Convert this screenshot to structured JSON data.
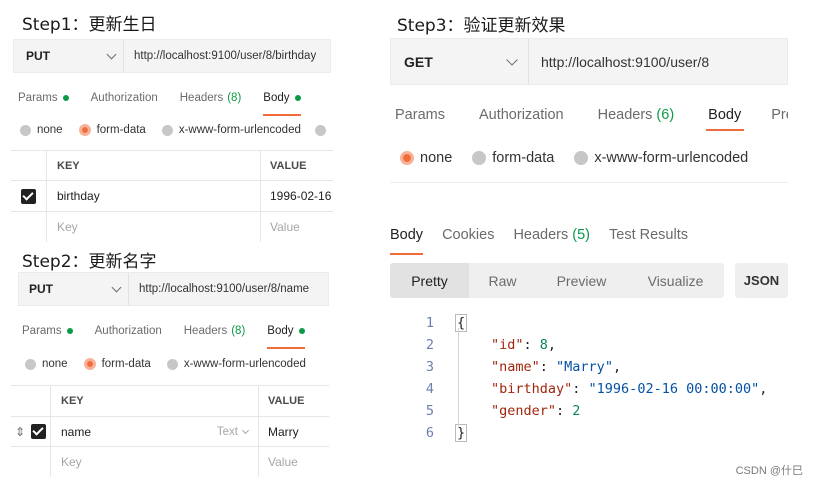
{
  "panel1": {
    "step_title": "Step1：更新生日",
    "method": "PUT",
    "url": "http://localhost:9100/user/8/birthday",
    "tabs": {
      "params": "Params",
      "authorization": "Authorization",
      "headers": "Headers",
      "headers_count": "(8)",
      "body": "Body"
    },
    "body_types": [
      "none",
      "form-data",
      "x-www-form-urlencoded"
    ],
    "table": {
      "col_key": "KEY",
      "col_value": "VALUE",
      "rows": [
        {
          "key": "birthday",
          "value": "1996-02-16",
          "checked": true
        }
      ],
      "key_placeholder": "Key",
      "value_placeholder": "Value"
    }
  },
  "panel2": {
    "step_title": "Step2：更新名字",
    "method": "PUT",
    "url": "http://localhost:9100/user/8/name",
    "tabs": {
      "params": "Params",
      "authorization": "Authorization",
      "headers": "Headers",
      "headers_count": "(8)",
      "body": "Body"
    },
    "body_types": [
      "none",
      "form-data",
      "x-www-form-urlencoded"
    ],
    "table": {
      "col_key": "KEY",
      "col_value": "VALUE",
      "rows": [
        {
          "key": "name",
          "type": "Text",
          "value": "Marry",
          "checked": true
        }
      ],
      "key_placeholder": "Key",
      "value_placeholder": "Value"
    }
  },
  "panel3": {
    "step_title": "Step3：验证更新效果",
    "method": "GET",
    "url": "http://localhost:9100/user/8",
    "tabs": {
      "params": "Params",
      "authorization": "Authorization",
      "headers": "Headers",
      "headers_count": "(6)",
      "body": "Body",
      "pre": "Pre"
    },
    "body_types": [
      "none",
      "form-data",
      "x-www-form-urlencoded"
    ],
    "response_tabs": {
      "body": "Body",
      "cookies": "Cookies",
      "headers": "Headers",
      "headers_count": "(5)",
      "test_results": "Test Results"
    },
    "view_modes": [
      "Pretty",
      "Raw",
      "Preview",
      "Visualize"
    ],
    "format": "JSON",
    "code": {
      "line_numbers": [
        "1",
        "2",
        "3",
        "4",
        "5",
        "6"
      ],
      "open_brace": "{",
      "close_brace": "}",
      "fields": [
        {
          "key": "\"id\"",
          "value": "8",
          "kind": "num",
          "comma": ","
        },
        {
          "key": "\"name\"",
          "value": "\"Marry\"",
          "kind": "str",
          "comma": ","
        },
        {
          "key": "\"birthday\"",
          "value": "\"1996-02-16 00:00:00\"",
          "kind": "str",
          "comma": ","
        },
        {
          "key": "\"gender\"",
          "value": "2",
          "kind": "num",
          "comma": ""
        }
      ]
    }
  },
  "watermark": "CSDN @什巳",
  "colors": {
    "accent": "#f26b3a",
    "green": "#0b9a45",
    "json_key": "#a1260d",
    "json_string": "#0451a5",
    "json_number": "#0b8658"
  }
}
